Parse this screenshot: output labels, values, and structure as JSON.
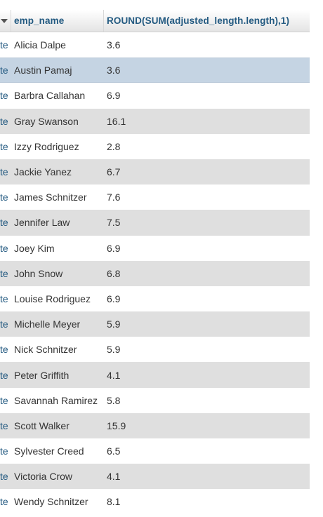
{
  "columns": {
    "emp_name": "emp_name",
    "sum": "ROUND(SUM(adjusted_length.length),1)"
  },
  "row_action_text": "te",
  "rows": [
    {
      "name": "Alicia Dalpe",
      "value": "3.6"
    },
    {
      "name": "Austin Pamaj",
      "value": "3.6"
    },
    {
      "name": "Barbra Callahan",
      "value": "6.9"
    },
    {
      "name": "Gray Swanson",
      "value": "16.1"
    },
    {
      "name": "Izzy Rodriguez",
      "value": "2.8"
    },
    {
      "name": "Jackie Yanez",
      "value": "6.7"
    },
    {
      "name": "James Schnitzer",
      "value": "7.6"
    },
    {
      "name": "Jennifer Law",
      "value": "7.5"
    },
    {
      "name": "Joey Kim",
      "value": "6.9"
    },
    {
      "name": "John Snow",
      "value": "6.8"
    },
    {
      "name": "Louise Rodriguez",
      "value": "6.9"
    },
    {
      "name": "Michelle Meyer",
      "value": "5.9"
    },
    {
      "name": "Nick Schnitzer",
      "value": "5.9"
    },
    {
      "name": "Peter Griffith",
      "value": "4.1"
    },
    {
      "name": "Savannah Ramirez",
      "value": "5.8"
    },
    {
      "name": "Scott Walker",
      "value": "15.9"
    },
    {
      "name": "Sylvester Creed",
      "value": "6.5"
    },
    {
      "name": "Victoria Crow",
      "value": "4.1"
    },
    {
      "name": "Wendy Schnitzer",
      "value": "8.1"
    }
  ]
}
